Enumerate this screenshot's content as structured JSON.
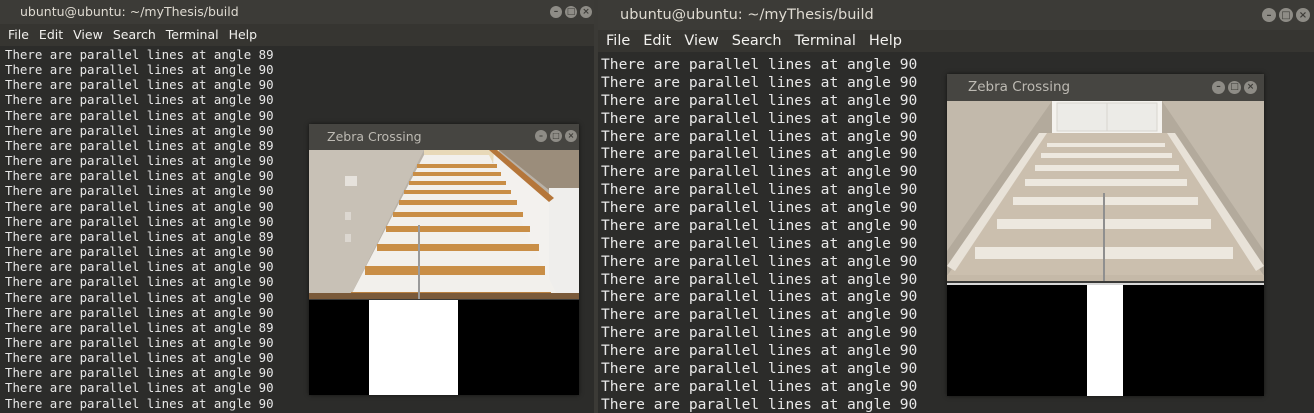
{
  "left_terminal": {
    "title": "ubuntu@ubuntu: ~/myThesis/build",
    "menu": [
      "File",
      "Edit",
      "View",
      "Search",
      "Terminal",
      "Help"
    ],
    "lines": [
      "There are parallel lines at angle 89",
      "There are parallel lines at angle 90",
      "There are parallel lines at angle 90",
      "There are parallel lines at angle 90",
      "There are parallel lines at angle 90",
      "There are parallel lines at angle 90",
      "There are parallel lines at angle 89",
      "There are parallel lines at angle 90",
      "There are parallel lines at angle 90",
      "There are parallel lines at angle 90",
      "There are parallel lines at angle 90",
      "There are parallel lines at angle 90",
      "There are parallel lines at angle 89",
      "There are parallel lines at angle 90",
      "There are parallel lines at angle 90",
      "There are parallel lines at angle 90",
      "There are parallel lines at angle 90",
      "There are parallel lines at angle 90",
      "There are parallel lines at angle 89",
      "There are parallel lines at angle 90",
      "There are parallel lines at angle 90",
      "There are parallel lines at angle 90",
      "There are parallel lines at angle 90",
      "There are parallel lines at angle 90"
    ],
    "window_buttons": [
      "minimize-icon",
      "maximize-icon",
      "close-icon"
    ]
  },
  "right_terminal": {
    "title": "ubuntu@ubuntu: ~/myThesis/build",
    "menu": [
      "File",
      "Edit",
      "View",
      "Search",
      "Terminal",
      "Help"
    ],
    "lines": [
      "There are parallel lines at angle 90",
      "There are parallel lines at angle 90",
      "There are parallel lines at angle 90",
      "There are parallel lines at angle 90",
      "There are parallel lines at angle 90",
      "There are parallel lines at angle 90",
      "There are parallel lines at angle 90",
      "There are parallel lines at angle 90",
      "There are parallel lines at angle 90",
      "There are parallel lines at angle 90",
      "There are parallel lines at angle 90",
      "There are parallel lines at angle 90",
      "There are parallel lines at angle 90",
      "There are parallel lines at angle 90",
      "There are parallel lines at angle 90",
      "There are parallel lines at angle 90",
      "There are parallel lines at angle 90",
      "There are parallel lines at angle 90",
      "There are parallel lines at angle 90",
      "There are parallel lines at angle 90"
    ],
    "window_buttons": [
      "minimize-icon",
      "maximize-icon",
      "close-icon"
    ]
  },
  "zebra_small": {
    "title": "Zebra Crossing"
  },
  "zebra_big": {
    "title": "Zebra Crossing"
  },
  "colors": {
    "terminal_bg": "#2c2c2a",
    "titlebar_bg": "#3c3b37",
    "text": "#e8e8e8"
  }
}
